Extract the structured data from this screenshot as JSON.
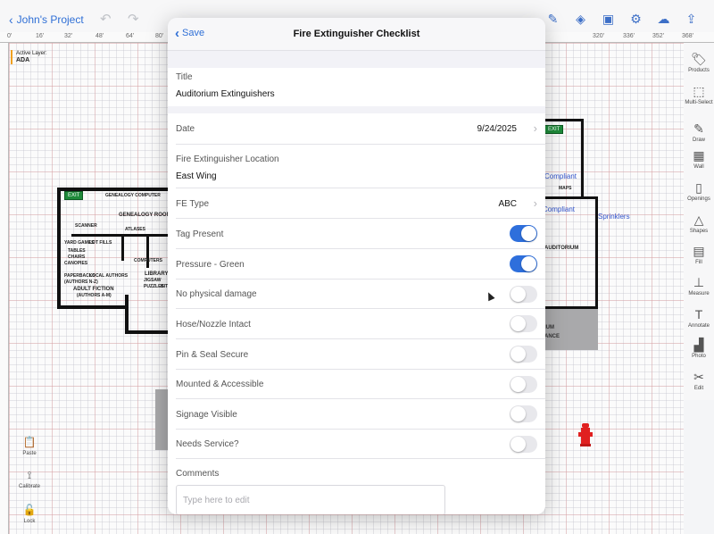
{
  "app": {
    "back_label": "John's Project",
    "active_layer_label": "Active Layer:",
    "active_layer_value": "ADA",
    "ruler_ticks": [
      "0'",
      "16'",
      "32'",
      "48'",
      "64'",
      "80'",
      "320'",
      "336'",
      "352'",
      "368'"
    ],
    "right_tools": [
      "Products",
      "Multi-Select",
      "Draw",
      "Wall",
      "Openings",
      "Shapes",
      "Fill",
      "Measure",
      "Annotate",
      "Photo",
      "Edit"
    ],
    "left_tools": [
      "Paste",
      "Calibrate",
      "Lock"
    ],
    "floorplan": {
      "exit_left": "EXIT",
      "exit_right": "EXIT",
      "genealogy_computer": "GENEALOGY COMPUTER",
      "genealogy_room": "GENEALOGY ROOM",
      "scanner": "SCANNER",
      "atlases": "ATLASES",
      "yard_games": "YARD GAMES",
      "lot_fills": "LOT FILLS",
      "tables": "TABLES",
      "chairs": "CHAIRS",
      "canopies": "CANOPIES",
      "paperbacks": "PAPERBACKS",
      "local_authors": "LOCAL AUTHORS",
      "computers": "COMPUTERS",
      "library_o": "LIBRARY O",
      "jigsaw": "JIGSAW",
      "puzzles": "PUZZLES",
      "kits": "KITS",
      "paperbacks2": "PAPERBACKS",
      "authors_nz": "(AUTHORS N-Z)",
      "adult_fiction": "ADULT FICTION",
      "authors_am": "(AUTHORS A-M)",
      "maps": "MAPS",
      "auditorium": "AUDITORIUM",
      "ium": "IUM",
      "ance": "ANCE",
      "note_compliant_1": "Compliant",
      "note_compliant_2": "Compliant",
      "note_sprinklers": "Sprinklers"
    }
  },
  "modal": {
    "save_label": "Save",
    "title": "Fire Extinguisher Checklist",
    "title_field_label": "Title",
    "title_field_value": "Auditorium Extinguishers",
    "date_label": "Date",
    "date_value": "9/24/2025",
    "location_label": "Fire Extinguisher Location",
    "location_value": "East Wing",
    "fe_type_label": "FE Type",
    "fe_type_value": "ABC",
    "toggles": [
      {
        "label": "Tag Present",
        "on": true
      },
      {
        "label": "Pressure - Green",
        "on": true
      },
      {
        "label": "No physical damage",
        "on": false
      },
      {
        "label": "Hose/Nozzle Intact",
        "on": false
      },
      {
        "label": "Pin & Seal Secure",
        "on": false
      },
      {
        "label": "Mounted & Accessible",
        "on": false
      },
      {
        "label": "Signage Visible",
        "on": false
      },
      {
        "label": "Needs Service?",
        "on": false
      }
    ],
    "comments_label": "Comments",
    "comments_placeholder": "Type here to edit"
  }
}
